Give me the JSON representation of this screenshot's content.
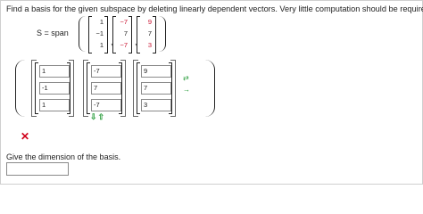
{
  "prompt": "Find a basis for the given subspace by deleting linearly dependent vectors. Very little computation should be required.",
  "span": {
    "label": "S = span",
    "vectors": [
      [
        "1",
        "−1",
        "1"
      ],
      [
        "−7",
        "7",
        "−7"
      ],
      [
        "9",
        "7",
        "3"
      ]
    ],
    "separator": ","
  },
  "answer": {
    "columns": [
      [
        "1",
        "-1",
        "1"
      ],
      [
        "-7",
        "7",
        "-7"
      ],
      [
        "9",
        "7",
        "3"
      ]
    ],
    "column_arrows": "⇩⇧",
    "side_arrows": [
      "⇄",
      "→"
    ]
  },
  "status_icon": "x-mark-icon",
  "status_color": "#d0021b",
  "accent_color": "#2a9d3c",
  "dimension": {
    "label": "Give the dimension of the basis.",
    "value": ""
  }
}
